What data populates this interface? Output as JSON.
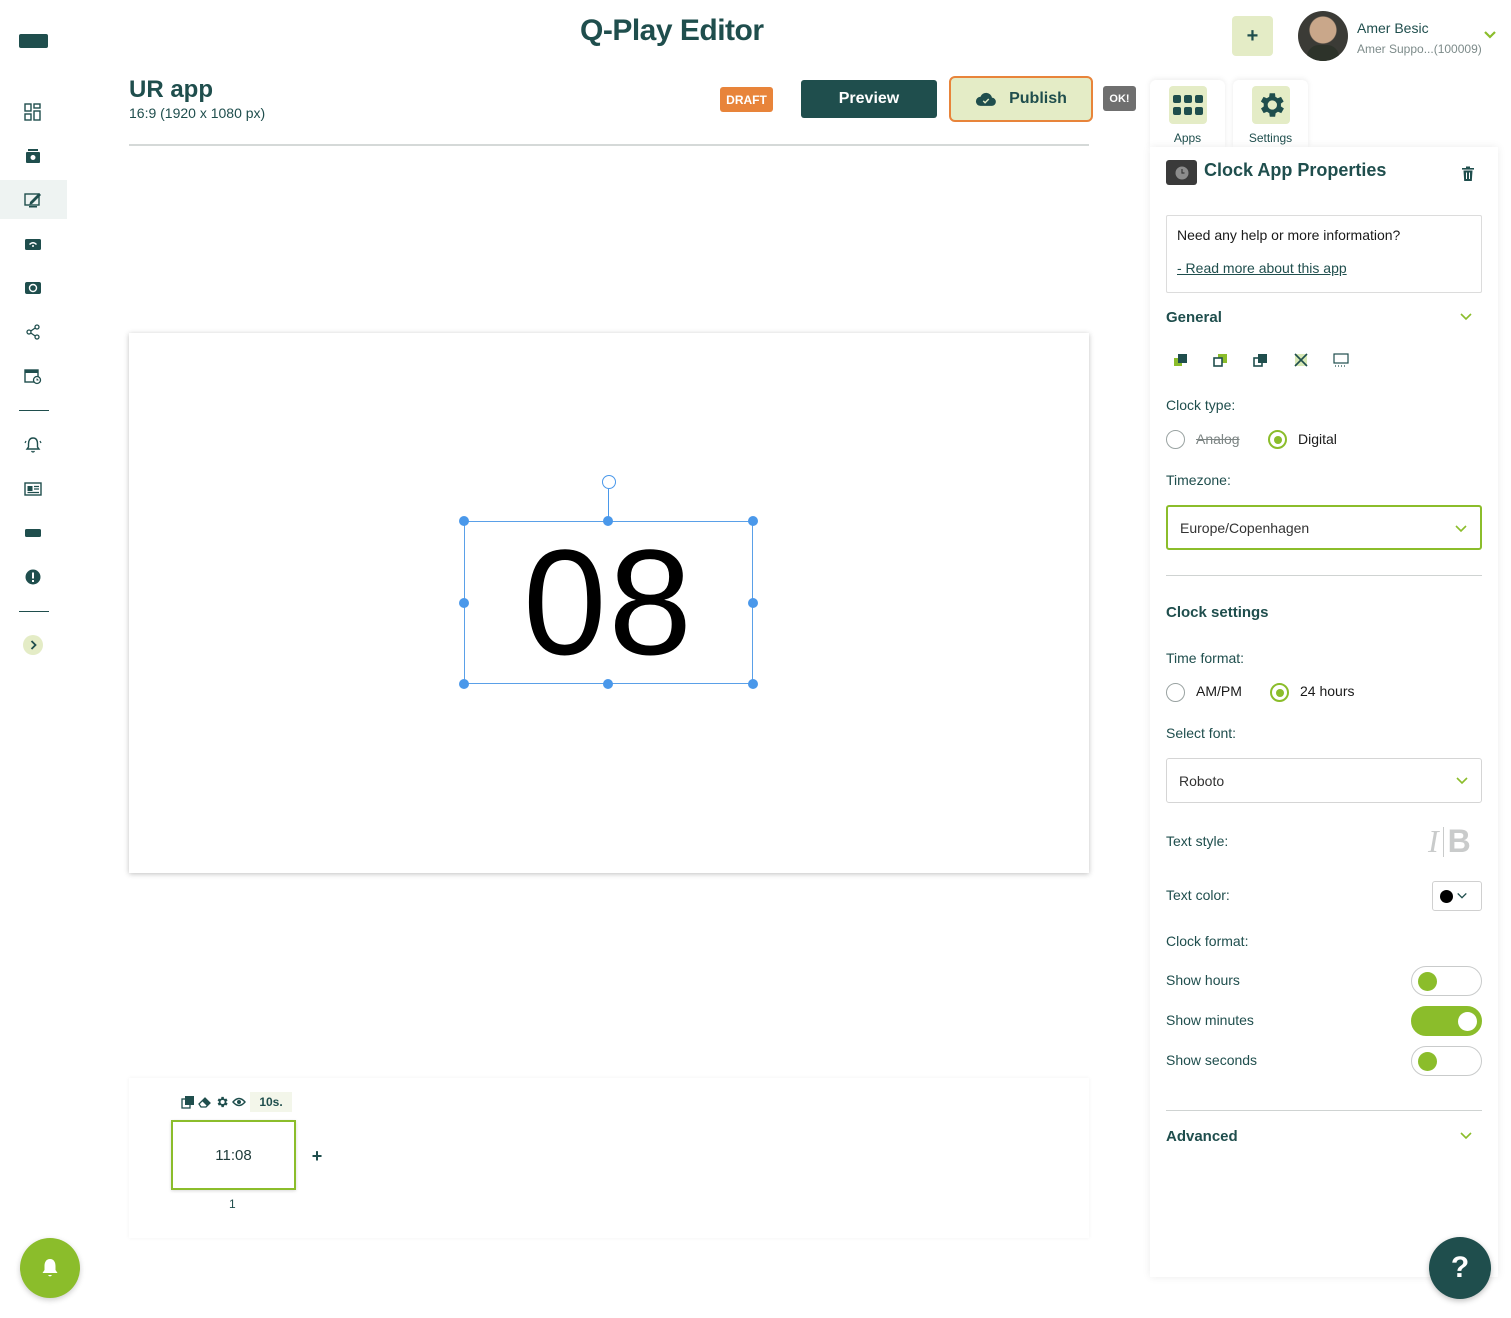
{
  "header": {
    "app_title": "Q-Play Editor",
    "add_label": "+",
    "user_name": "Amer Besic",
    "user_sub": "Amer Suppo...(100009)"
  },
  "document": {
    "title": "UR app",
    "resolution": "16:9 (1920 x 1080 px)",
    "status_badge": "DRAFT",
    "preview_label": "Preview",
    "publish_label": "Publish",
    "ok_badge": "OK!"
  },
  "tabs": [
    {
      "label": "Apps",
      "icon": "apps-grid-icon"
    },
    {
      "label": "Settings",
      "icon": "gear-icon"
    }
  ],
  "canvas": {
    "clock_text": "08"
  },
  "timeline": {
    "duration": "10s.",
    "slides": [
      {
        "label": "11:08",
        "number": "1"
      }
    ],
    "add_label": "+"
  },
  "properties": {
    "title": "Clock App Properties",
    "help_question": "Need any help or more information?",
    "help_link": "- Read more about this app",
    "general": {
      "title": "General",
      "clock_type_label": "Clock type:",
      "clock_type_options": [
        "Analog",
        "Digital"
      ],
      "clock_type_selected": "Digital",
      "timezone_label": "Timezone:",
      "timezone_value": "Europe/Copenhagen"
    },
    "clock_settings": {
      "title": "Clock settings",
      "time_format_label": "Time format:",
      "time_format_options": [
        "AM/PM",
        "24 hours"
      ],
      "time_format_selected": "24 hours",
      "font_label": "Select font:",
      "font_value": "Roboto",
      "text_style_label": "Text style:",
      "text_style_italic": "I",
      "text_style_bold": "B",
      "text_color_label": "Text color:",
      "text_color": "#000000",
      "clock_format_label": "Clock format:",
      "toggles": [
        {
          "label": "Show hours",
          "on": false
        },
        {
          "label": "Show minutes",
          "on": true
        },
        {
          "label": "Show seconds",
          "on": false
        }
      ]
    },
    "advanced": {
      "title": "Advanced"
    }
  },
  "fab": {
    "help": "?"
  },
  "colors": {
    "brand_dark": "#1f4e4d",
    "accent_green": "#8bbd2b",
    "accent_orange": "#e8843a",
    "light_green": "#e4ecc6"
  }
}
